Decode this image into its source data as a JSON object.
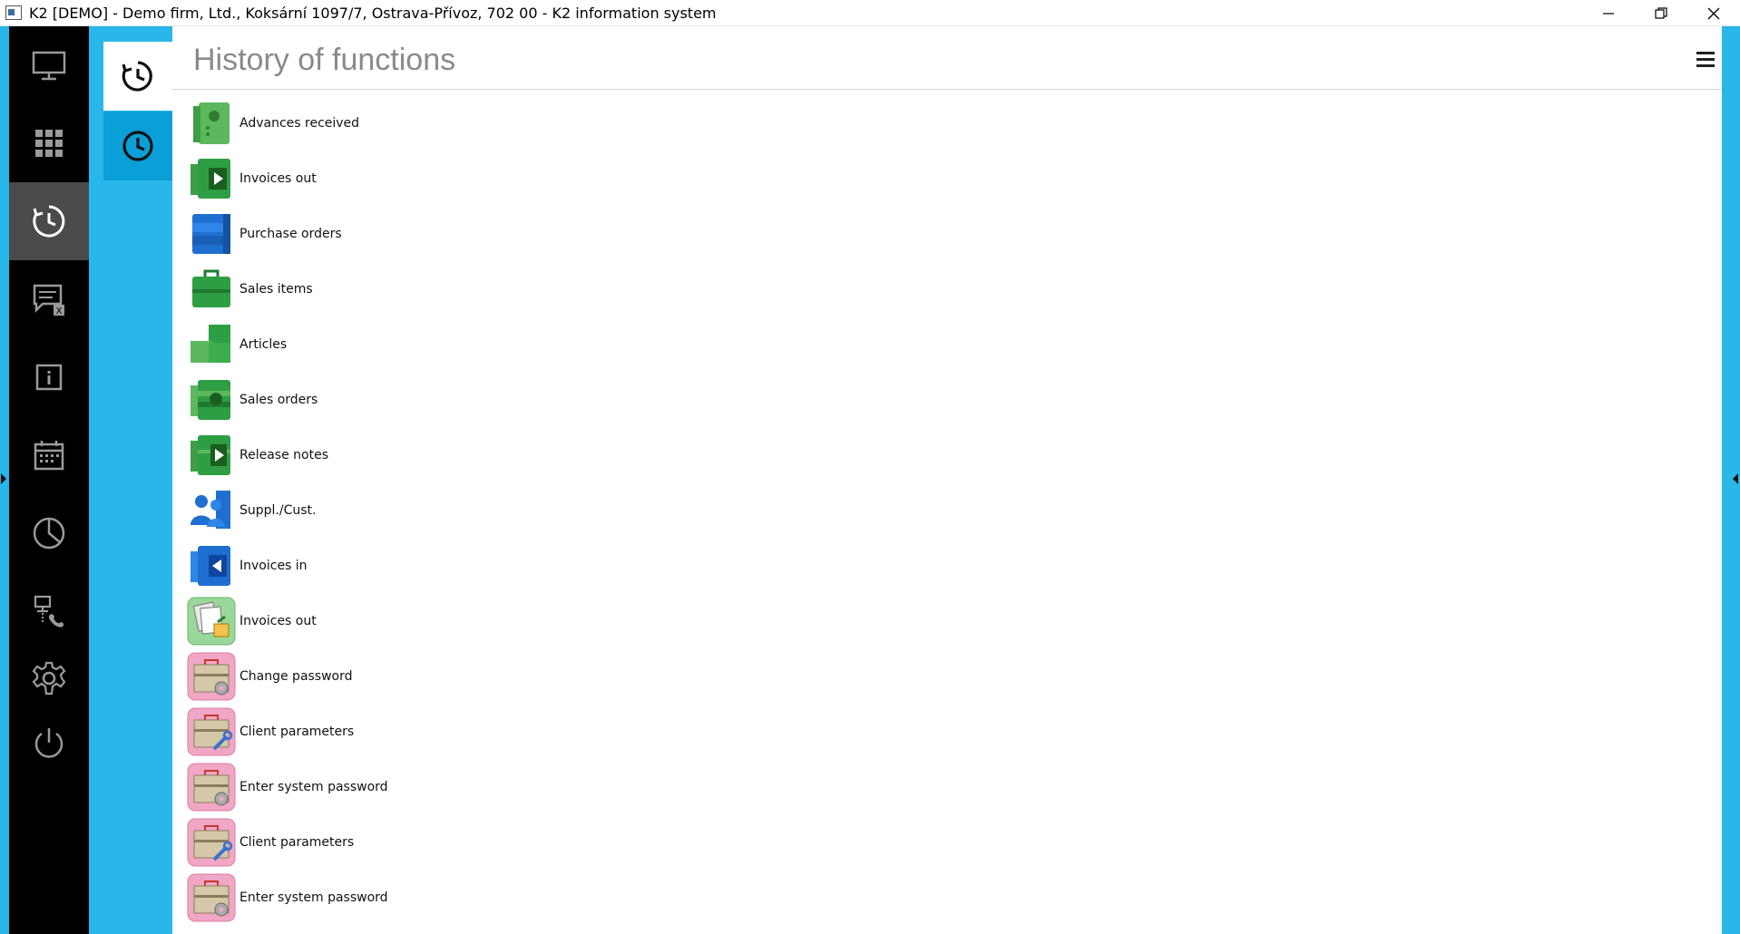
{
  "window": {
    "title": "K2 [DEMO] - Demo firm, Ltd., Koksární 1097/7, Ostrava-Přívoz, 702 00 - K2 information system"
  },
  "sidebar": {
    "items": [
      {
        "icon": "monitor-icon"
      },
      {
        "icon": "apps-grid-icon"
      },
      {
        "icon": "history-icon",
        "active": true
      },
      {
        "icon": "messages-icon",
        "badge": "X"
      },
      {
        "icon": "info-icon"
      },
      {
        "icon": "calendar-icon"
      },
      {
        "icon": "pie-chart-icon"
      },
      {
        "icon": "network-phone-icon"
      },
      {
        "icon": "gear-icon"
      },
      {
        "icon": "power-icon"
      }
    ]
  },
  "tabs": [
    {
      "icon": "history-icon",
      "active": true
    },
    {
      "icon": "clock-icon",
      "active": false
    }
  ],
  "main": {
    "title": "History of functions",
    "menu_icon": "hamburger-menu-icon",
    "items": [
      {
        "label": "Advances received",
        "icon": "advances-icon",
        "color": "#5cb85c"
      },
      {
        "label": "Invoices out",
        "icon": "invoice-out-icon",
        "color": "#2e9e44"
      },
      {
        "label": "Purchase orders",
        "icon": "purchase-orders-icon",
        "color": "#1f6fd1"
      },
      {
        "label": "Sales items",
        "icon": "sales-items-icon",
        "color": "#2e9e44"
      },
      {
        "label": "Articles",
        "icon": "articles-icon",
        "color": "#3cae4e"
      },
      {
        "label": "Sales orders",
        "icon": "sales-orders-icon",
        "color": "#2e9e44"
      },
      {
        "label": "Release notes",
        "icon": "release-notes-icon",
        "color": "#2e9e44"
      },
      {
        "label": "Suppl./Cust.",
        "icon": "suppliers-customers-icon",
        "color": "#1f6fd1"
      },
      {
        "label": "Invoices in",
        "icon": "invoice-in-icon",
        "color": "#1f6fd1"
      },
      {
        "label": "Invoices out",
        "icon": "invoice-out-legacy-icon",
        "color": "#8fd18f"
      },
      {
        "label": "Change password",
        "icon": "toolbox-gear-icon",
        "color": "#f2a6c6"
      },
      {
        "label": "Client parameters",
        "icon": "toolbox-wrench-icon",
        "color": "#f2a6c6"
      },
      {
        "label": "Enter system password",
        "icon": "toolbox-gear-icon",
        "color": "#f2a6c6"
      },
      {
        "label": "Client parameters",
        "icon": "toolbox-wrench-icon",
        "color": "#f2a6c6"
      },
      {
        "label": "Enter system password",
        "icon": "toolbox-gear-icon",
        "color": "#f2a6c6"
      }
    ]
  }
}
